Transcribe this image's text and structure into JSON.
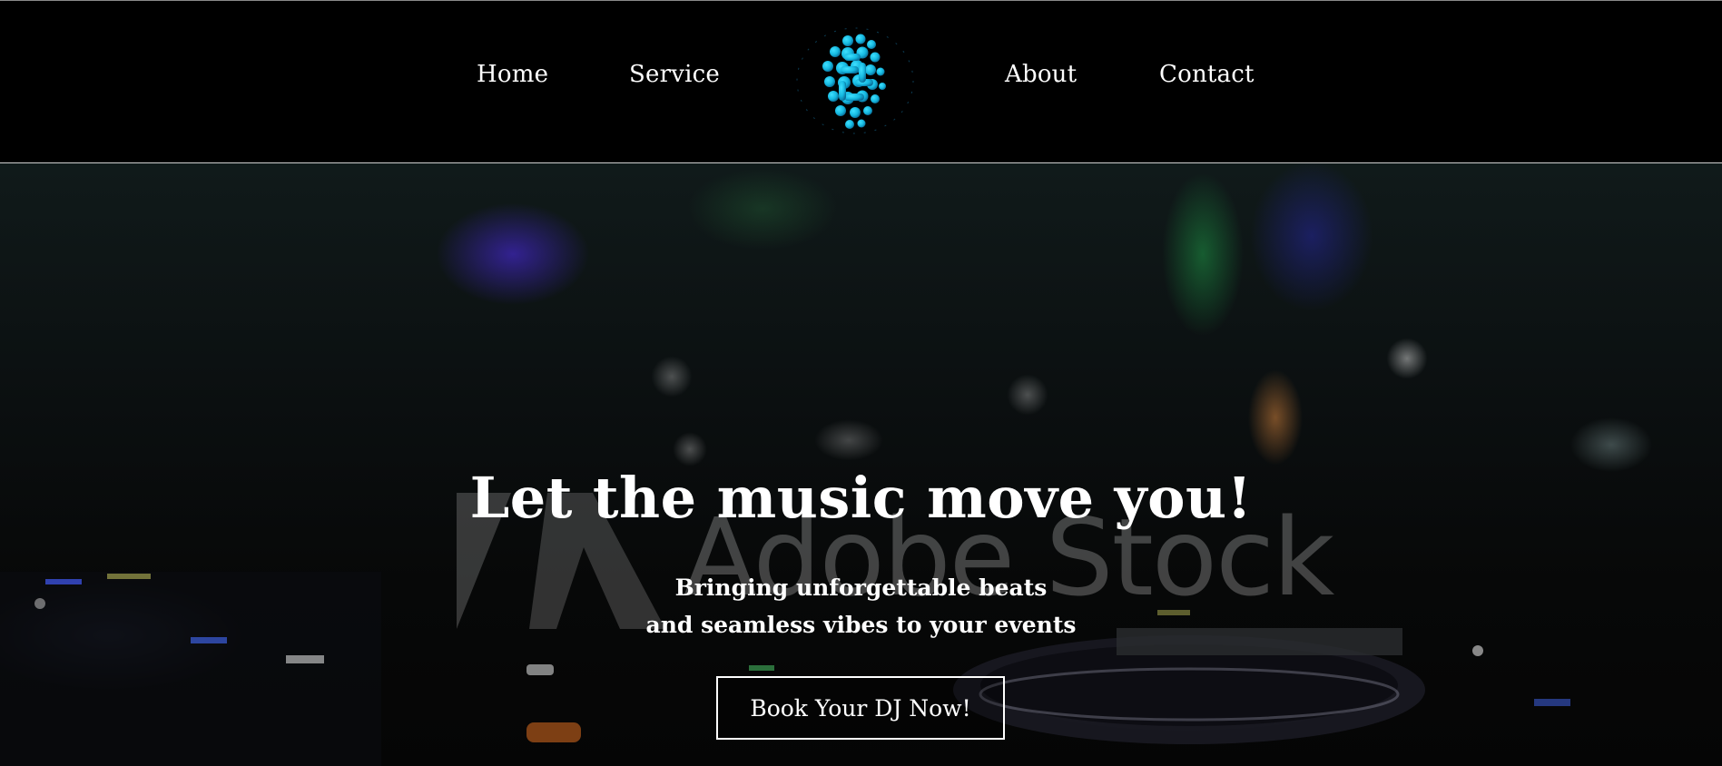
{
  "header": {
    "nav_left": [
      {
        "label": "Home"
      },
      {
        "label": "Service"
      }
    ],
    "nav_right": [
      {
        "label": "About"
      },
      {
        "label": "Contact"
      }
    ],
    "logo": {
      "icon": "globe-dots-icon",
      "color": "#18c4e8"
    }
  },
  "hero": {
    "headline": "Let the music move you!",
    "subline_1": "Bringing unforgettable beats",
    "subline_2": "and seamless vibes to your events",
    "cta_label": "Book Your DJ Now!",
    "watermark_text": "Adobe Stock"
  },
  "colors": {
    "background": "#000000",
    "text": "#ffffff",
    "accent": "#18c4e8"
  }
}
